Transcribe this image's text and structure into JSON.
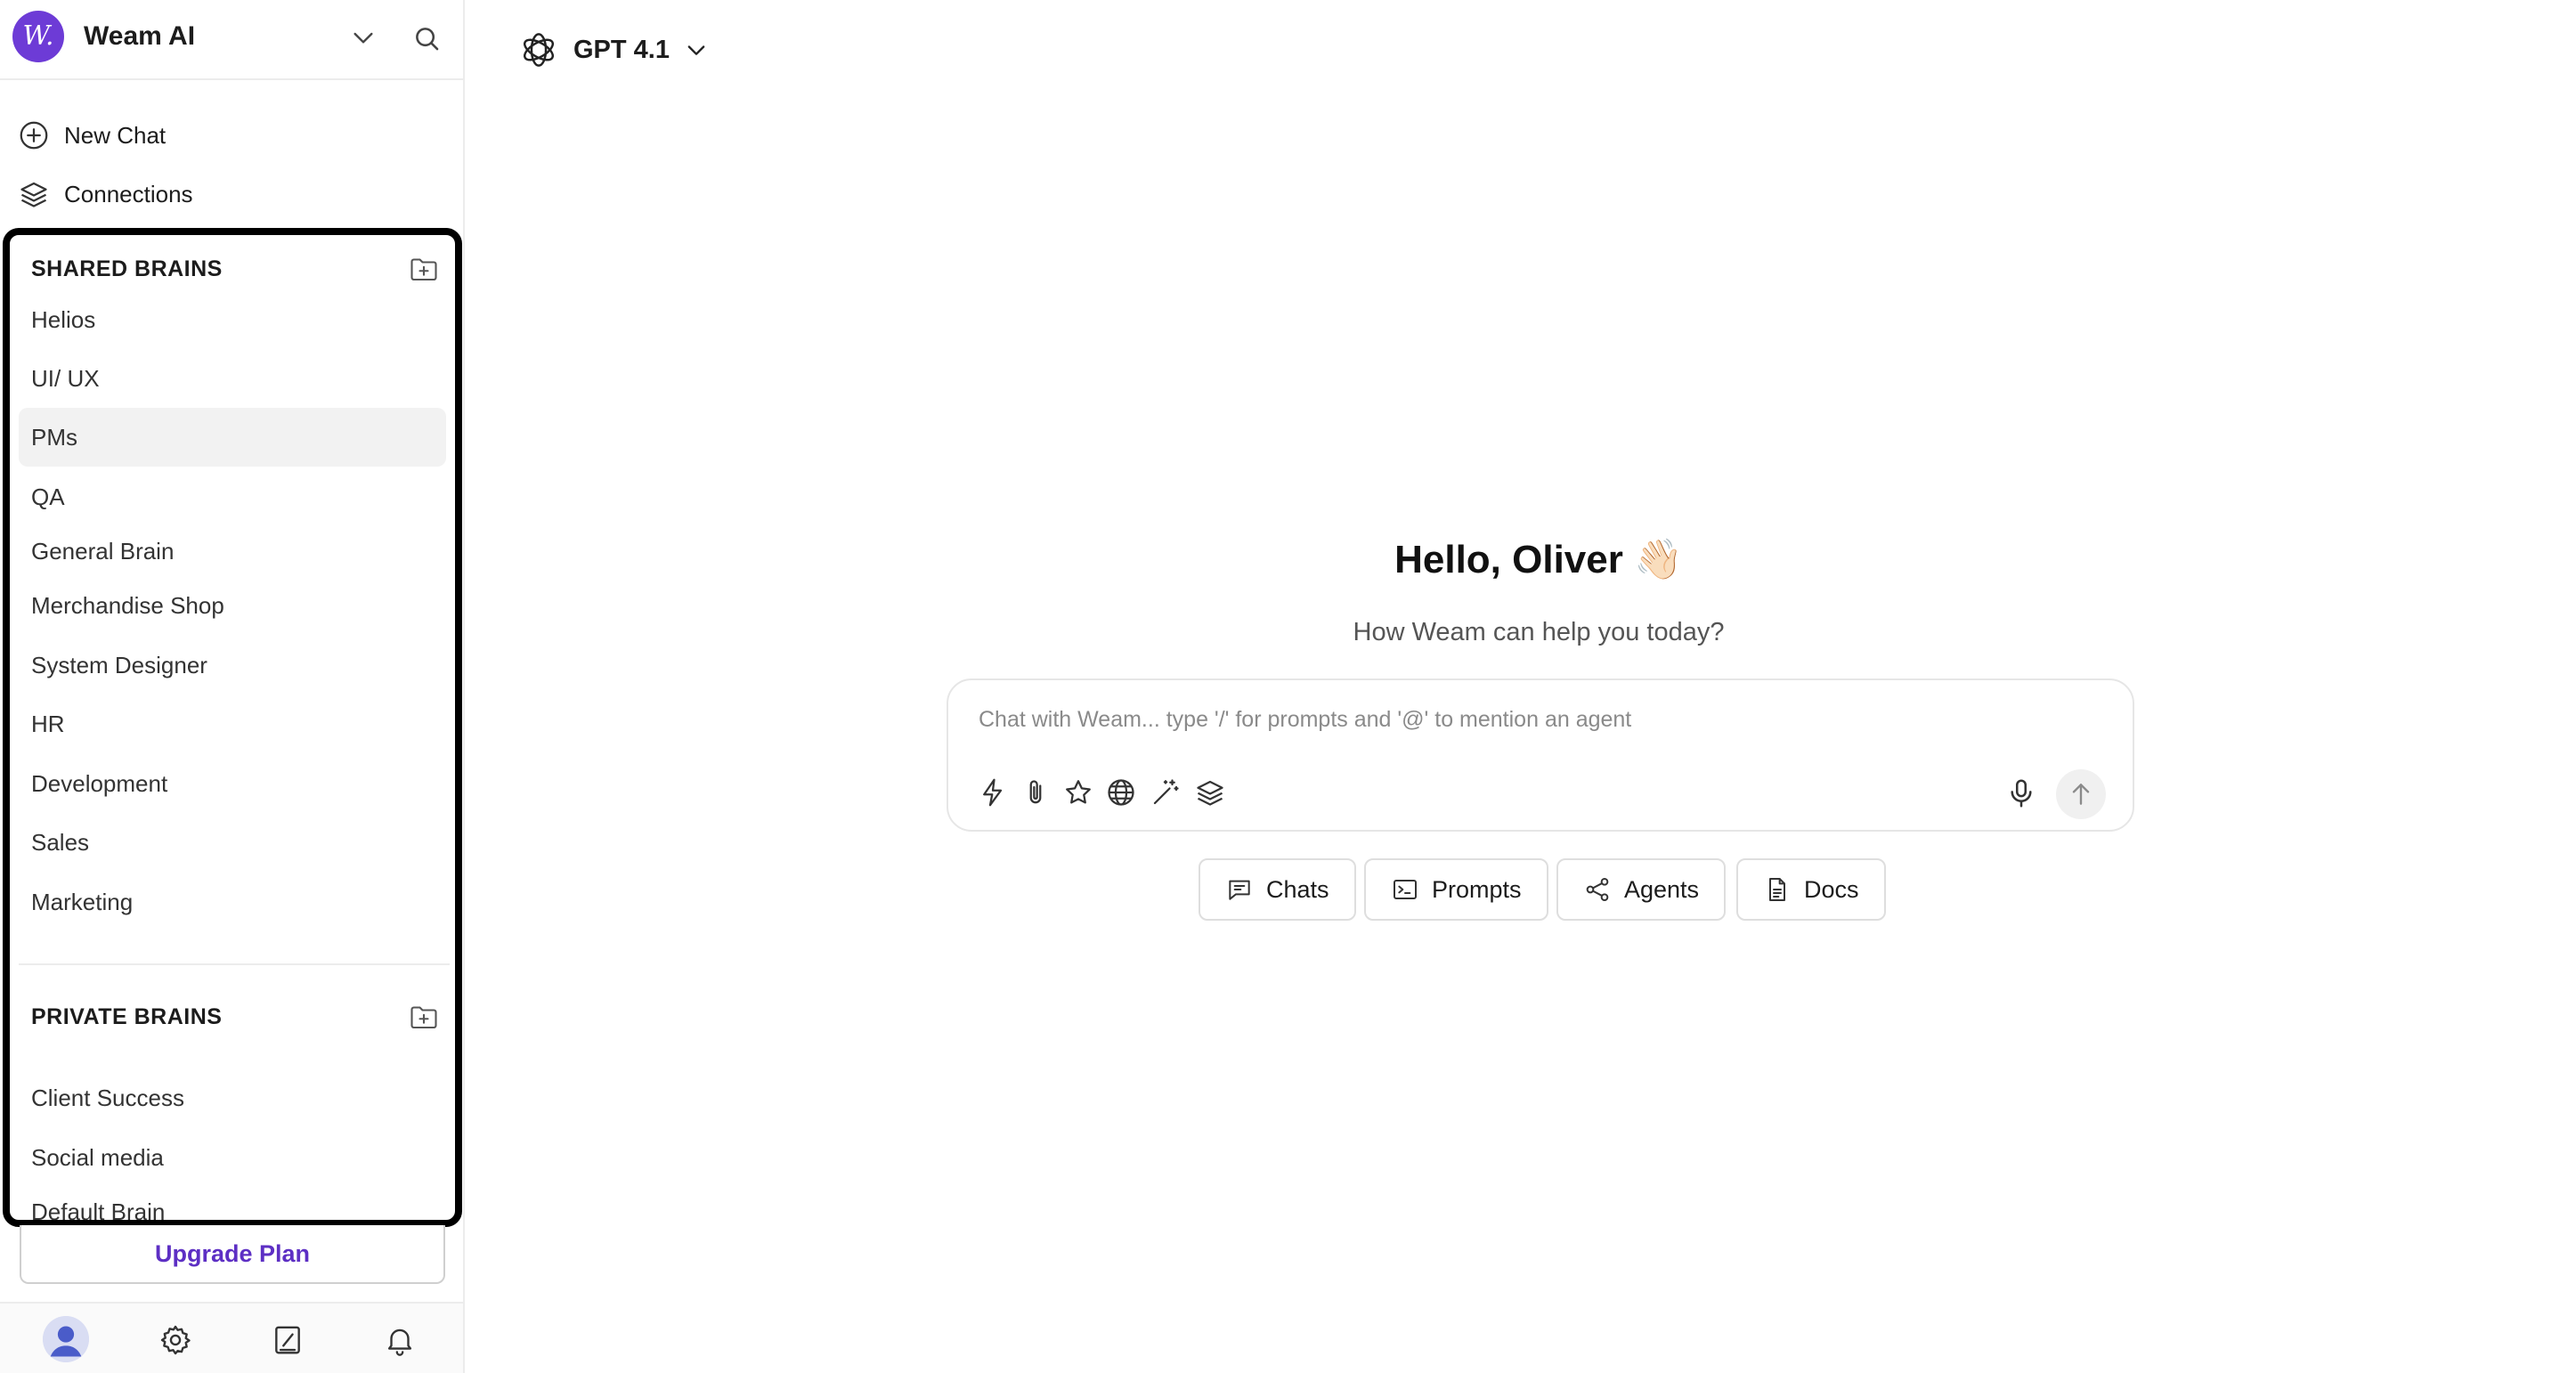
{
  "sidebar": {
    "brand": {
      "logo_text": "W.",
      "name": "Weam AI"
    },
    "nav": [
      {
        "label": "New Chat",
        "icon": "plus-circle-icon"
      },
      {
        "label": "Connections",
        "icon": "layers-icon"
      }
    ],
    "shared_brains": {
      "title": "SHARED BRAINS",
      "items": [
        "Helios",
        "UI/ UX",
        "PMs",
        "QA",
        "General Brain",
        "Merchandise Shop",
        "System Designer",
        "HR",
        "Development",
        "Sales",
        "Marketing"
      ],
      "active": "PMs"
    },
    "private_brains": {
      "title": "PRIVATE BRAINS",
      "items": [
        "Client Success",
        "Social media",
        "Default Brain"
      ]
    },
    "upgrade_label": "Upgrade Plan",
    "bottom_icons": [
      "user-avatar",
      "gear-icon",
      "notebook-icon",
      "bell-icon"
    ]
  },
  "main": {
    "model": {
      "name": "GPT 4.1",
      "icon": "openai-logo-icon"
    },
    "greeting": "Hello, Oliver 👋🏻",
    "subtitle": "How Weam can help you today?",
    "chat_input": {
      "placeholder": "Chat with Weam... type '/' for prompts and '@' to mention an agent",
      "value": ""
    },
    "tools": [
      "bolt-icon",
      "paperclip-icon",
      "star-icon",
      "globe-icon",
      "magic-wand-icon",
      "layers-icon"
    ],
    "quick_actions": [
      {
        "label": "Chats",
        "icon": "chat-bubble-icon"
      },
      {
        "label": "Prompts",
        "icon": "terminal-icon"
      },
      {
        "label": "Agents",
        "icon": "nodes-icon"
      },
      {
        "label": "Docs",
        "icon": "document-icon"
      }
    ]
  },
  "colors": {
    "brand": "#6d3bd6",
    "upgrade_text": "#5d2fc4",
    "panel_border": "#000000",
    "active_item_bg": "#f2f2f2"
  }
}
